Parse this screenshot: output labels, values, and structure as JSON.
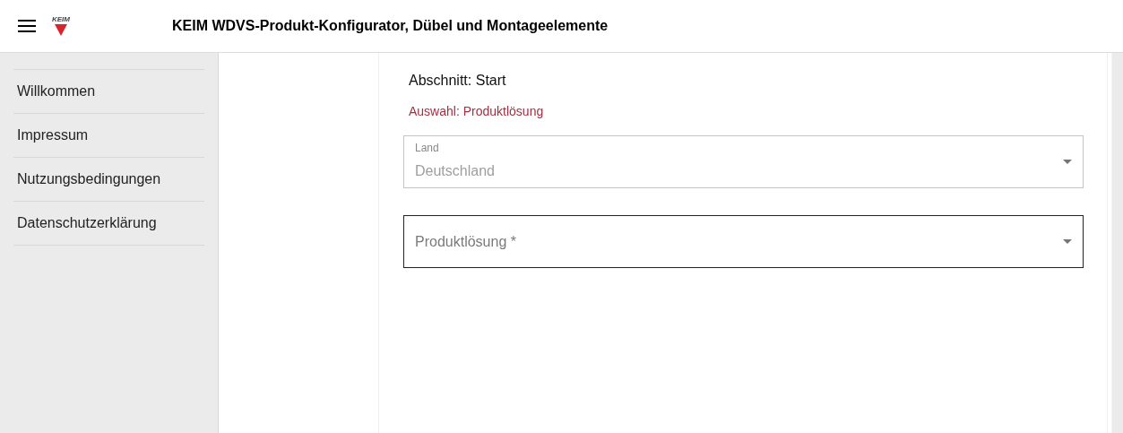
{
  "header": {
    "logo_text": "KEIM",
    "title": "KEIM WDVS-Produkt-Konfigurator, Dübel und Montageelemente"
  },
  "sidebar": {
    "items": [
      {
        "label": "Willkommen"
      },
      {
        "label": "Impressum"
      },
      {
        "label": "Nutzungsbedingungen"
      },
      {
        "label": "Datenschutzerklärung"
      }
    ]
  },
  "form": {
    "section": "Abschnitt: Start",
    "selection": "Auswahl: Produktlösung",
    "fields": [
      {
        "label": "Land",
        "value": "Deutschland",
        "disabled": true
      },
      {
        "placeholder": "Produktlösung *",
        "disabled": false
      }
    ]
  }
}
